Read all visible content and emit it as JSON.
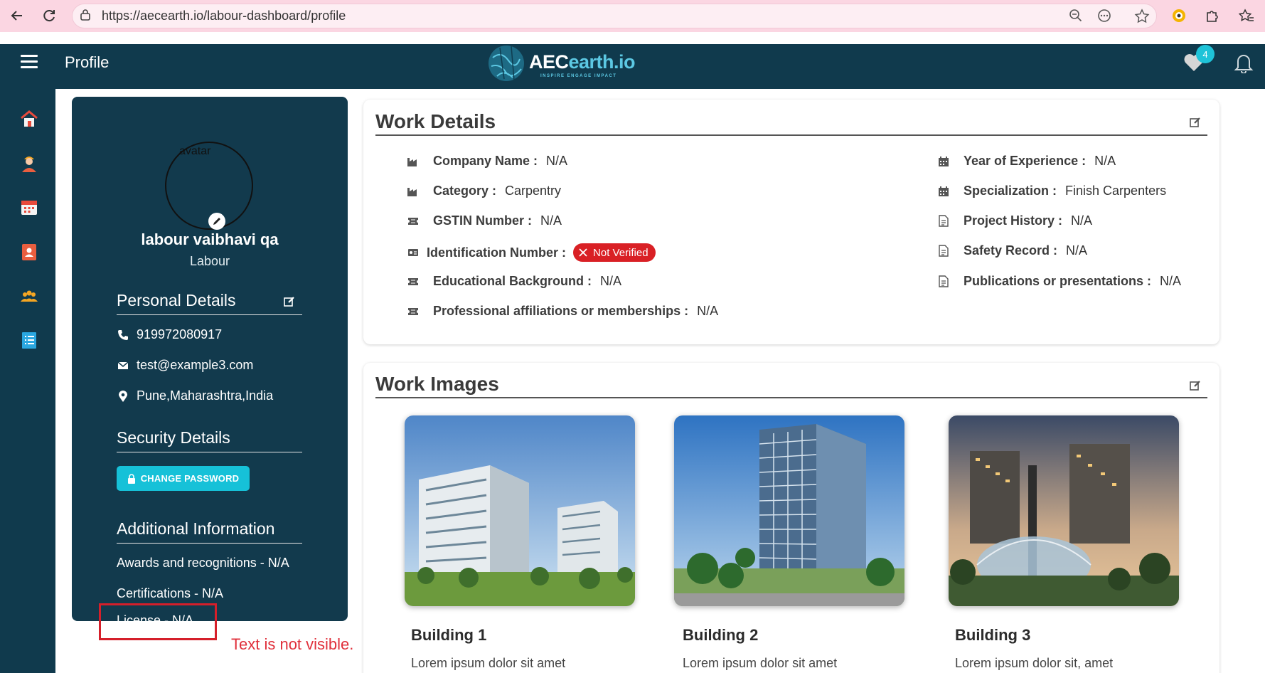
{
  "browser": {
    "url": "https://aecearth.io/labour-dashboard/profile"
  },
  "header": {
    "page_title": "Profile",
    "logo_text_a": "AEC",
    "logo_text_b": "earth.io",
    "logo_tagline": "INSPIRE ENGAGE IMPACT",
    "notification_count": "4"
  },
  "sidebar": {
    "items": [
      {
        "icon": "home-icon"
      },
      {
        "icon": "worker-icon"
      },
      {
        "icon": "calendar-icon"
      },
      {
        "icon": "contact-book-icon"
      },
      {
        "icon": "group-icon"
      },
      {
        "icon": "list-icon"
      }
    ]
  },
  "profile": {
    "avatar_alt": "avatar",
    "name": "labour vaibhavi qa",
    "role": "Labour",
    "personal_details_title": "Personal Details",
    "phone": "919972080917",
    "email": "test@example3.com",
    "location": "Pune,Maharashtra,India",
    "security_details_title": "Security Details",
    "change_password_label": "CHANGE PASSWORD",
    "additional_info_title": "Additional Information",
    "awards": "Awards and recognitions -  N/A",
    "certifications": "Certifications -  N/A",
    "license": "License -  N/A"
  },
  "work_details": {
    "title": "Work Details",
    "left": [
      {
        "label": "Company Name :",
        "value": "N/A"
      },
      {
        "label": "Category :",
        "value": "Carpentry"
      },
      {
        "label": "GSTIN Number :",
        "value": "N/A"
      },
      {
        "label": "Identification Number :",
        "value": "Not Verified"
      },
      {
        "label": "Educational Background :",
        "value": "N/A"
      },
      {
        "label": "Professional affiliations or memberships :",
        "value": "N/A"
      }
    ],
    "right": [
      {
        "label": "Year of Experience :",
        "value": "N/A"
      },
      {
        "label": "Specialization :",
        "value": "Finish Carpenters"
      },
      {
        "label": "Project History :",
        "value": "N/A"
      },
      {
        "label": "Safety Record :",
        "value": "N/A"
      },
      {
        "label": "Publications or presentations :",
        "value": "N/A"
      }
    ]
  },
  "work_images": {
    "title": "Work Images",
    "items": [
      {
        "title": "Building 1",
        "desc": "Lorem ipsum dolor sit amet"
      },
      {
        "title": "Building 2",
        "desc": "Lorem ipsum dolor sit amet"
      },
      {
        "title": "Building 3",
        "desc": "Lorem ipsum dolor sit, amet"
      }
    ]
  },
  "annotation": {
    "note": "Text is not visible."
  },
  "colors": {
    "header_bg": "#103a4d",
    "accent": "#16c1d8",
    "error_chip": "#d92025",
    "annotation_red": "#d51f2a"
  }
}
